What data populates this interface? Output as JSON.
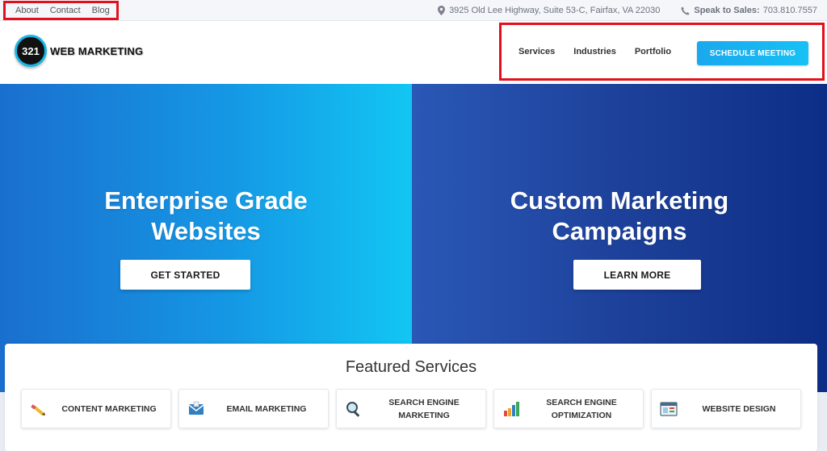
{
  "topbar": {
    "links": [
      "About",
      "Contact",
      "Blog"
    ],
    "address": "3925 Old Lee Highway, Suite 53-C, Fairfax, VA 22030",
    "sales_label": "Speak to Sales:",
    "sales_phone": "703.810.7557"
  },
  "header": {
    "logo_badge": "321",
    "logo_text": "WEB MARKETING",
    "nav": [
      "Services",
      "Industries",
      "Portfolio"
    ],
    "cta": "SCHEDULE MEETING"
  },
  "hero": {
    "left": {
      "title_line1": "Enterprise Grade",
      "title_line2": "Websites",
      "button": "GET STARTED"
    },
    "right": {
      "title_line1": "Custom Marketing",
      "title_line2": "Campaigns",
      "button": "LEARN MORE"
    }
  },
  "featured": {
    "heading": "Featured Services",
    "cards": [
      {
        "line1": "CONTENT MARKETING",
        "line2": "",
        "icon": "pencil-icon"
      },
      {
        "line1": "EMAIL MARKETING",
        "line2": "",
        "icon": "envelope-icon"
      },
      {
        "line1": "SEARCH ENGINE",
        "line2": "MARKETING",
        "icon": "magnifier-icon"
      },
      {
        "line1": "SEARCH ENGINE",
        "line2": "OPTIMIZATION",
        "icon": "bar-chart-icon"
      },
      {
        "line1": "WEBSITE DESIGN",
        "line2": "",
        "icon": "browser-window-icon"
      }
    ]
  },
  "colors": {
    "accent": "#16b4ee",
    "highlight_box": "#e3101b",
    "hero_left": "#1597e4",
    "hero_right": "#1c3f98"
  }
}
